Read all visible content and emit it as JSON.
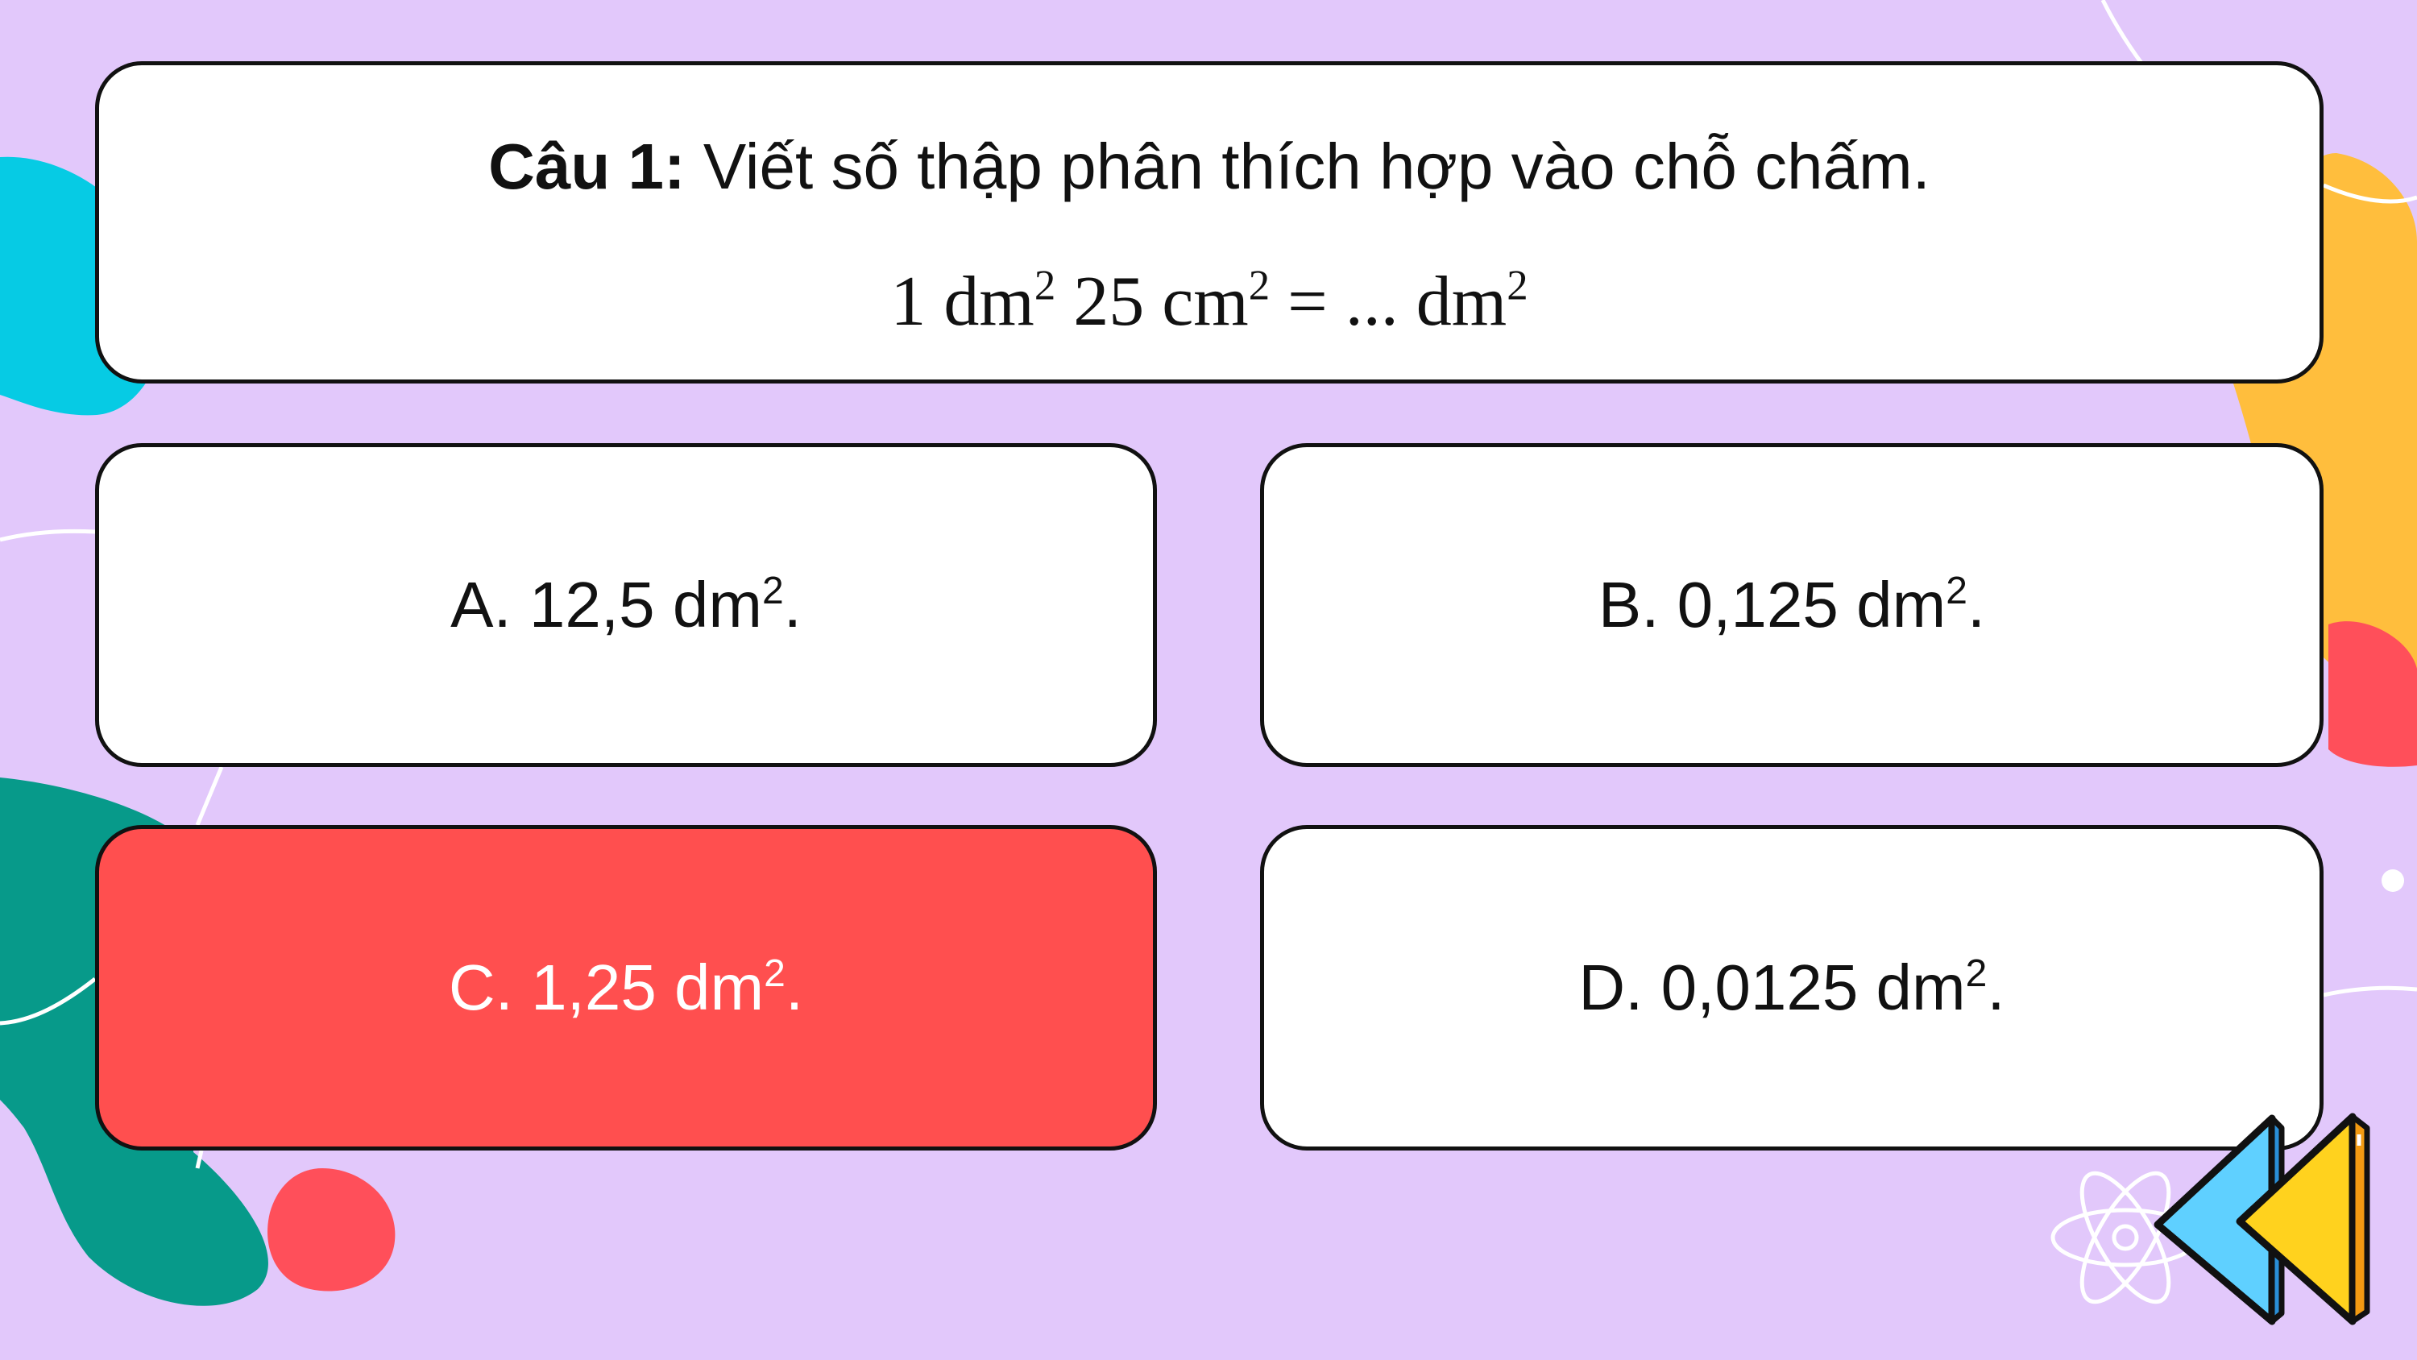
{
  "question": {
    "prefix": "Câu 1:",
    "text": " Viết số thập phân thích hợp vào chỗ chấm.",
    "expression": {
      "part1": "1 dm",
      "sup1": "2",
      "part2": " 25 cm",
      "sup2": "2",
      "part3": " = ... dm",
      "sup3": "2"
    }
  },
  "answers": [
    {
      "label": "A. 12,5 dm",
      "sup": "2",
      "suffix": ".",
      "selected": false
    },
    {
      "label": "B. 0,125 dm",
      "sup": "2",
      "suffix": ".",
      "selected": false
    },
    {
      "label": "C. 1,25 dm",
      "sup": "2",
      "suffix": ".",
      "selected": true
    },
    {
      "label": "D. 0,0125 dm",
      "sup": "2",
      "suffix": ".",
      "selected": false
    }
  ],
  "colors": {
    "background": "#E2C8FB",
    "card": "#FFFFFF",
    "selected_answer": "#FF4F4F",
    "border": "#111111"
  },
  "icons": {
    "back_button": "double-chevron-left-icon",
    "decoration": "atom-icon"
  }
}
